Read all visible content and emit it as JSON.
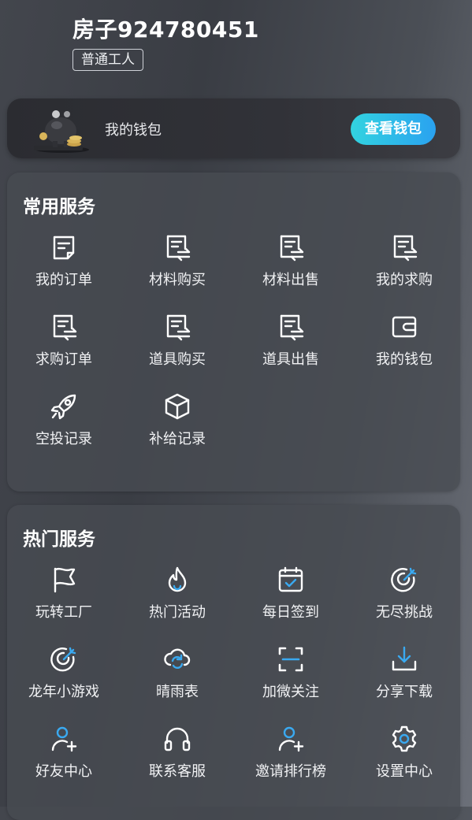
{
  "profile": {
    "username": "房子924780451",
    "role": "普通工人"
  },
  "wallet": {
    "label": "我的钱包",
    "button": "查看钱包"
  },
  "common_services": {
    "title": "常用服务",
    "items": [
      {
        "label": "我的订单",
        "icon": "order-icon"
      },
      {
        "label": "材料购买",
        "icon": "document-exchange-icon"
      },
      {
        "label": "材料出售",
        "icon": "document-exchange-icon"
      },
      {
        "label": "我的求购",
        "icon": "document-exchange-icon"
      },
      {
        "label": "求购订单",
        "icon": "document-exchange-icon"
      },
      {
        "label": "道具购买",
        "icon": "document-exchange-icon"
      },
      {
        "label": "道具出售",
        "icon": "document-exchange-icon"
      },
      {
        "label": "我的钱包",
        "icon": "wallet-icon"
      },
      {
        "label": "空投记录",
        "icon": "rocket-icon"
      },
      {
        "label": "补给记录",
        "icon": "box-icon"
      }
    ]
  },
  "hot_services": {
    "title": "热门服务",
    "items": [
      {
        "label": "玩转工厂",
        "icon": "flag-icon"
      },
      {
        "label": "热门活动",
        "icon": "flame-icon"
      },
      {
        "label": "每日签到",
        "icon": "calendar-check-icon"
      },
      {
        "label": "无尽挑战",
        "icon": "target-icon"
      },
      {
        "label": "龙年小游戏",
        "icon": "target-icon"
      },
      {
        "label": "晴雨表",
        "icon": "cloud-refresh-icon"
      },
      {
        "label": "加微关注",
        "icon": "scan-icon"
      },
      {
        "label": "分享下载",
        "icon": "download-icon"
      },
      {
        "label": "好友中心",
        "icon": "user-add-icon"
      },
      {
        "label": "联系客服",
        "icon": "headset-icon"
      },
      {
        "label": "邀请排行榜",
        "icon": "user-add-icon"
      },
      {
        "label": "设置中心",
        "icon": "gear-icon"
      }
    ]
  },
  "colors": {
    "accent": "#2aa2f0",
    "accent_start": "#32d3e0",
    "icon_stroke": "#ffffff"
  }
}
